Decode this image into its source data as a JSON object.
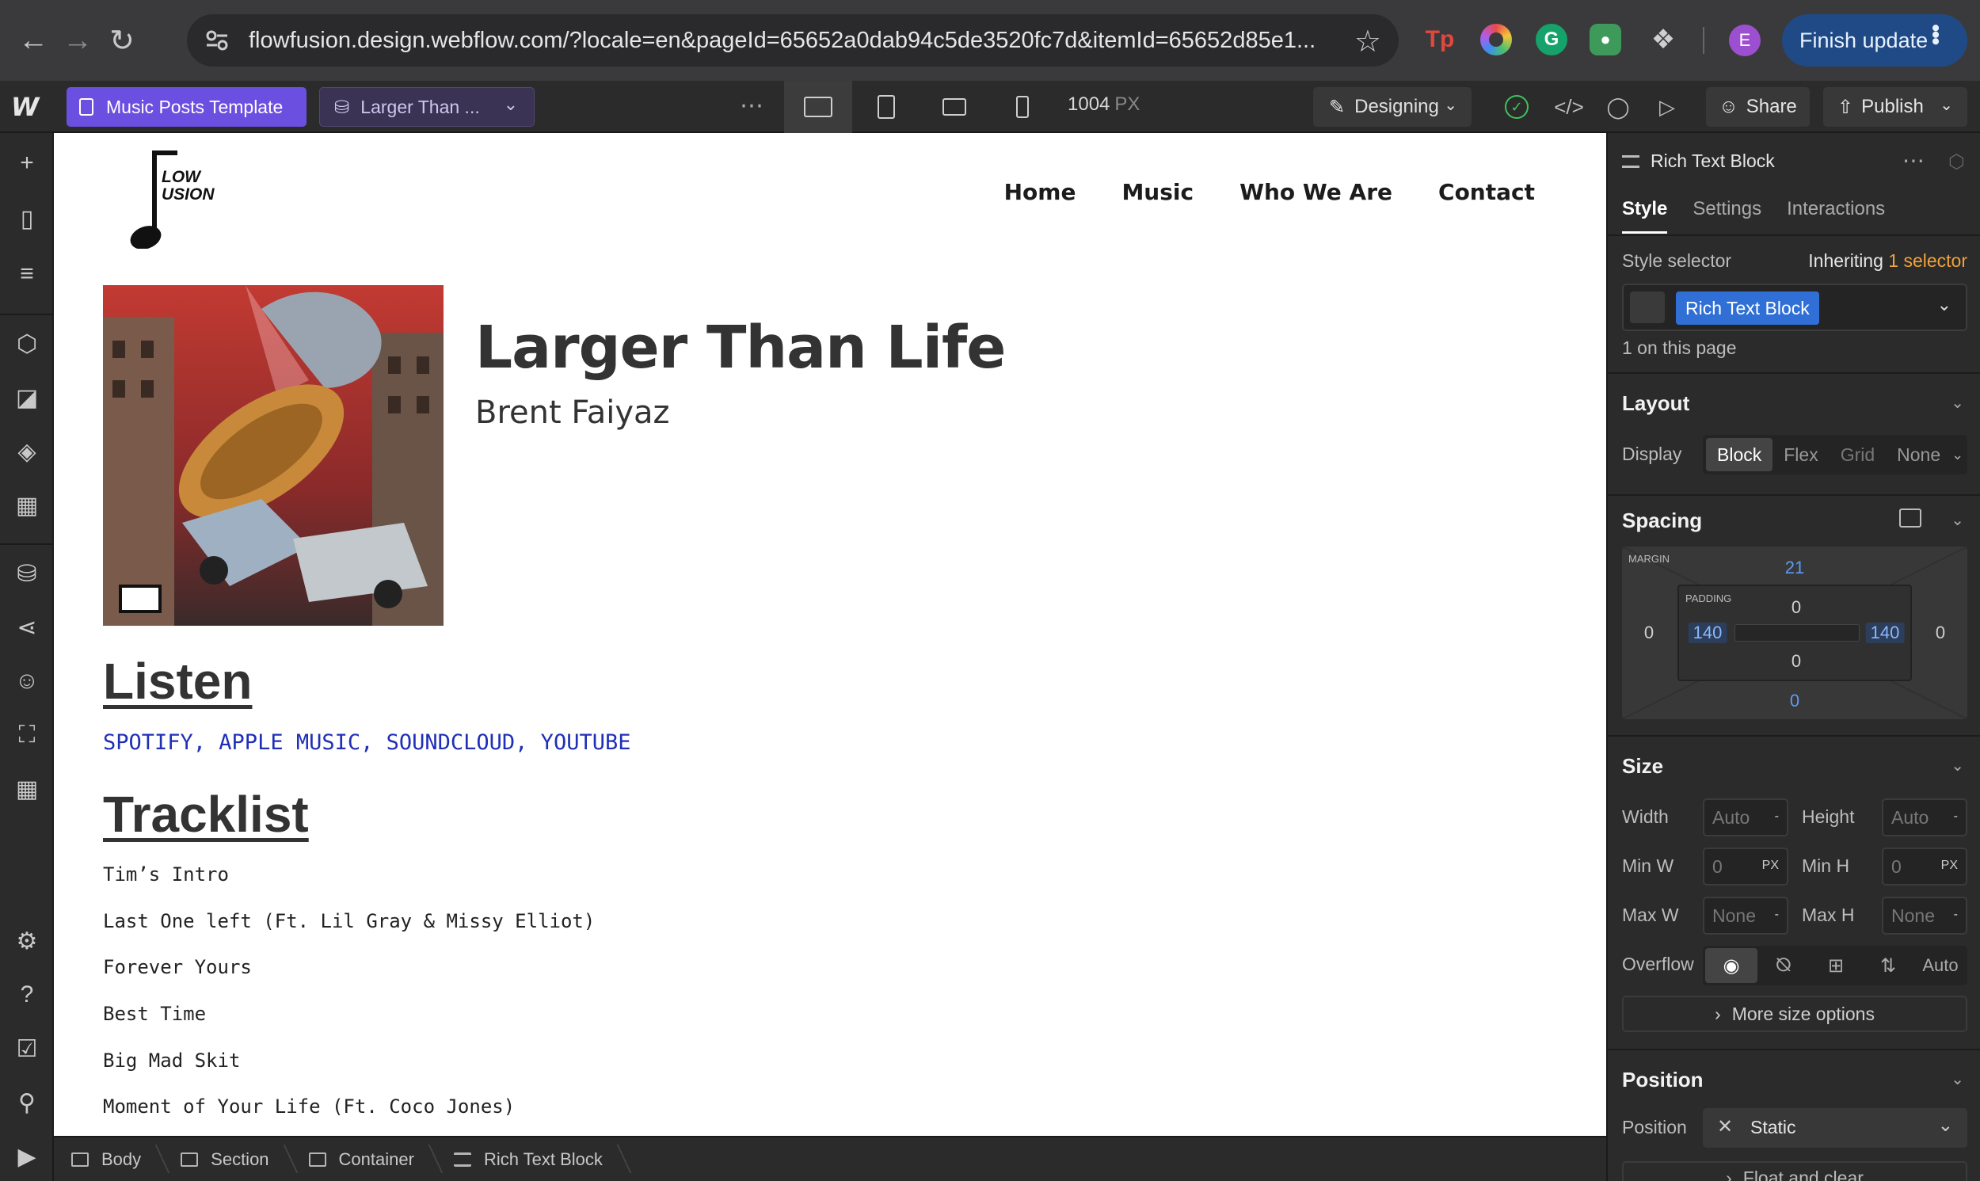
{
  "browser": {
    "url": "flowfusion.design.webflow.com/?locale=en&pageId=65652a0dab94c5de3520fc7d&itemId=65652d85e1...",
    "profile_initial": "E",
    "finish_update_label": "Finish update",
    "ext_tp_label": "Tp",
    "ext_g_label": "G"
  },
  "toolbar": {
    "page_name": "Music Posts Template",
    "item_name": "Larger Than ...",
    "width_value": "1004",
    "width_unit": "PX",
    "mode_label": "Designing",
    "share_label": "Share",
    "publish_label": "Publish"
  },
  "site": {
    "logo_line1": "LOW",
    "logo_line2": "USION",
    "nav": [
      "Home",
      "Music",
      "Who We Are",
      "Contact"
    ]
  },
  "content": {
    "album_title": "Larger Than Life",
    "artist": "Brent Faiyaz",
    "listen_heading": "Listen",
    "listen_links": "SPOTIFY, APPLE MUSIC, SOUNDCLOUD, YOUTUBE",
    "tracklist_heading": "Tracklist",
    "tracks": [
      "Tim’s Intro",
      "Last One left (Ft. Lil Gray & Missy Elliot)",
      "Forever Yours",
      "Best Time",
      "Big Mad Skit",
      "Moment of Your Life (Ft. Coco Jones)"
    ]
  },
  "breadcrumb": [
    "Body",
    "Section",
    "Container",
    "Rich Text Block"
  ],
  "panel": {
    "element_title": "Rich Text Block",
    "tabs": [
      "Style",
      "Settings",
      "Interactions"
    ],
    "style_selector_label": "Style selector",
    "inheriting_prefix": "Inheriting",
    "inheriting_count": "1 selector",
    "selector_tag": "Rich Text Block",
    "on_page": "1 on this page",
    "layout": {
      "title": "Layout",
      "display_label": "Display",
      "options": [
        "Block",
        "Flex",
        "Grid",
        "None"
      ]
    },
    "spacing": {
      "title": "Spacing",
      "margin_label": "MARGIN",
      "padding_label": "PADDING",
      "margin_top": "21",
      "margin_right": "0",
      "margin_bottom": "0",
      "margin_left": "0",
      "padding_top": "0",
      "padding_right": "140",
      "padding_bottom": "0",
      "padding_left": "140"
    },
    "size": {
      "title": "Size",
      "width_label": "Width",
      "width_value": "Auto",
      "height_label": "Height",
      "height_value": "Auto",
      "minw_label": "Min W",
      "minw_value": "0",
      "minh_label": "Min H",
      "minh_value": "0",
      "maxw_label": "Max W",
      "maxw_value": "None",
      "maxh_label": "Max H",
      "maxh_value": "None",
      "unit_px": "PX",
      "unit_dash": "-",
      "overflow_label": "Overflow",
      "overflow_auto": "Auto",
      "more_options": "More size options"
    },
    "position": {
      "title": "Position",
      "position_label": "Position",
      "position_value": "Static",
      "float_label": "Float and clear"
    }
  },
  "colors": {
    "accent_purple": "#6b4fe0",
    "selector_blue": "#2f6fd6",
    "link_blue": "#1f2fb8",
    "success_green": "#3ec35b"
  }
}
